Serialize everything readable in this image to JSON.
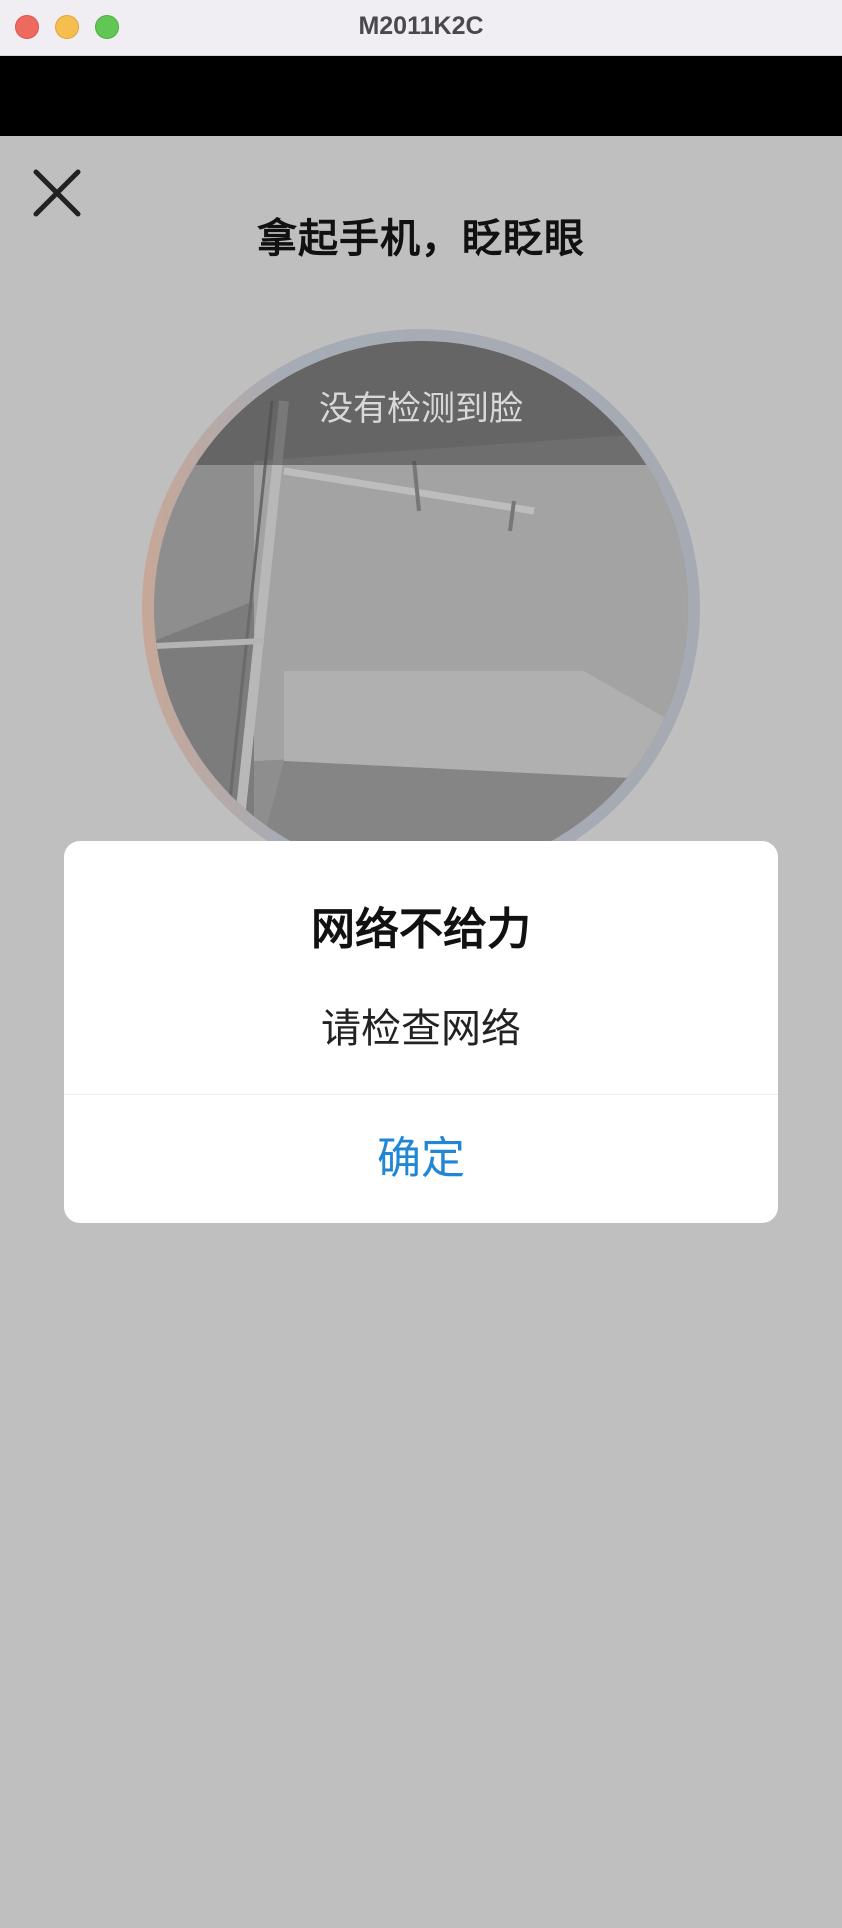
{
  "window": {
    "title": "M2011K2C"
  },
  "header": {
    "close_icon": "close-icon",
    "instruction": "拿起手机，眨眨眼"
  },
  "camera": {
    "status_text": "没有检测到脸"
  },
  "dialog": {
    "title": "网络不给力",
    "message": "请检查网络",
    "confirm_label": "确定"
  },
  "colors": {
    "background": "#bfbfbf",
    "accent": "#1f87d6",
    "dialog_bg": "#ffffff"
  }
}
